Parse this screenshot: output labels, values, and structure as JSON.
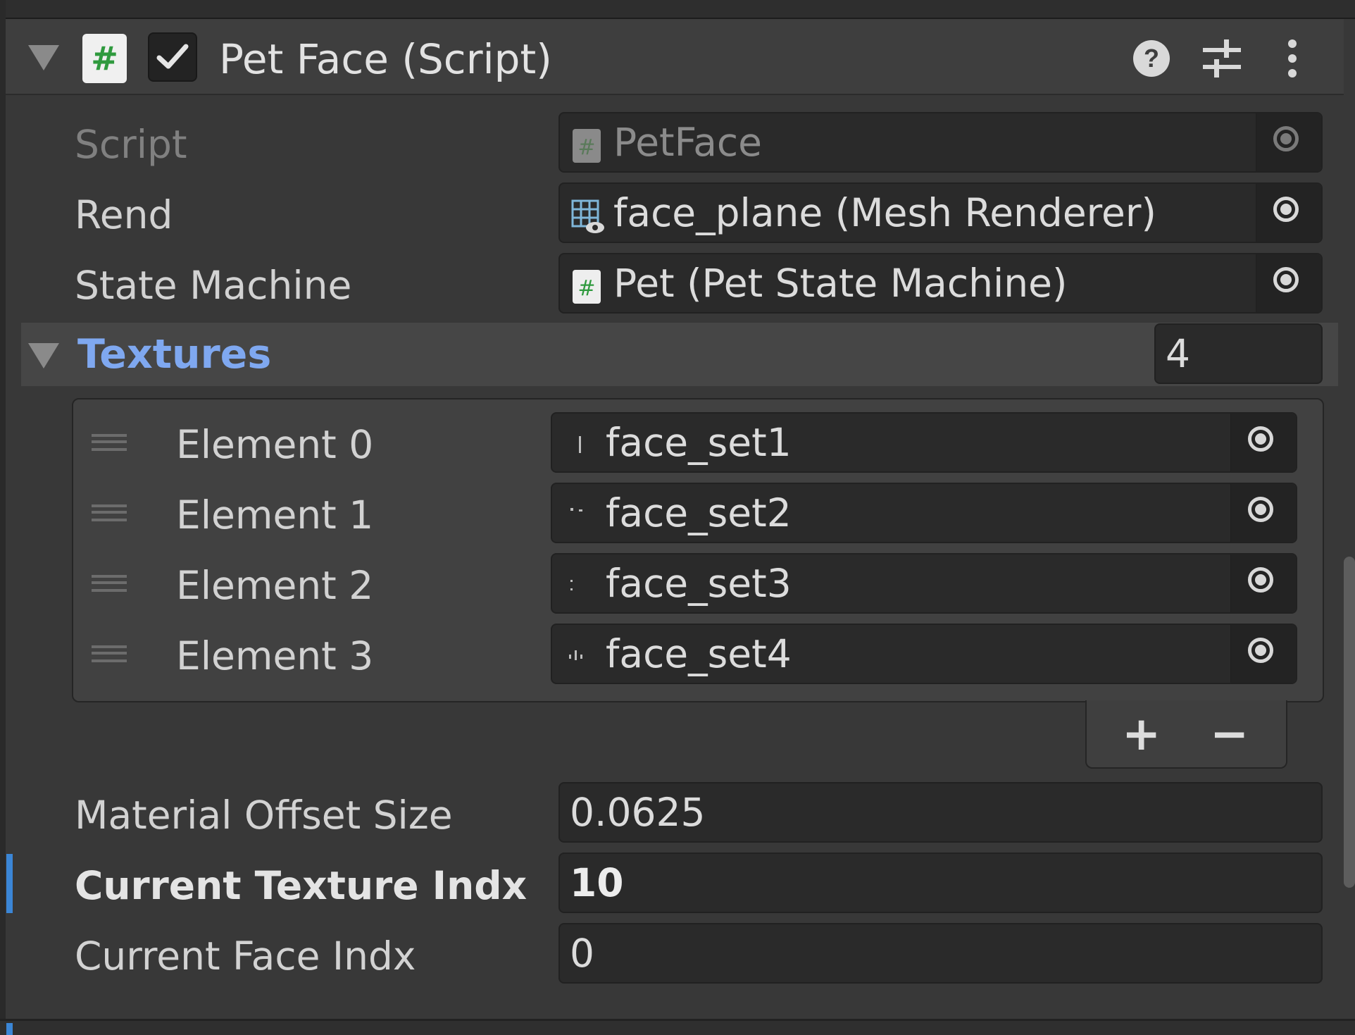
{
  "component": {
    "title": "Pet Face (Script)",
    "enabled": true,
    "icons": [
      "collapse-arrow-icon",
      "script-icon",
      "help-icon",
      "presets-icon",
      "kebab-menu-icon"
    ]
  },
  "fields": {
    "script": {
      "label": "Script",
      "value": "PetFace",
      "icon": "script-icon"
    },
    "rend": {
      "label": "Rend",
      "value": "face_plane (Mesh Renderer)",
      "icon": "mesh-renderer-icon"
    },
    "state_machine": {
      "label": "State Machine",
      "value": "Pet (Pet State Machine)",
      "icon": "script-icon"
    }
  },
  "textures": {
    "label": "Textures",
    "size": "4",
    "elements": [
      {
        "label": "Element 0",
        "value": "face_set1"
      },
      {
        "label": "Element 1",
        "value": "face_set2"
      },
      {
        "label": "Element 2",
        "value": "face_set3"
      },
      {
        "label": "Element 3",
        "value": "face_set4"
      }
    ],
    "add_label": "+",
    "remove_label": "−"
  },
  "material_offset_size": {
    "label": "Material Offset Size",
    "value": "0.0625"
  },
  "current_texture_indx": {
    "label": "Current Texture Indx",
    "value": "10"
  },
  "current_face_indx": {
    "label": "Current Face Indx",
    "value": "0"
  },
  "colors": {
    "accent_link": "#7fa8f0",
    "modified_bar": "#3b86d6",
    "script_hash": "#2f9a3e"
  }
}
